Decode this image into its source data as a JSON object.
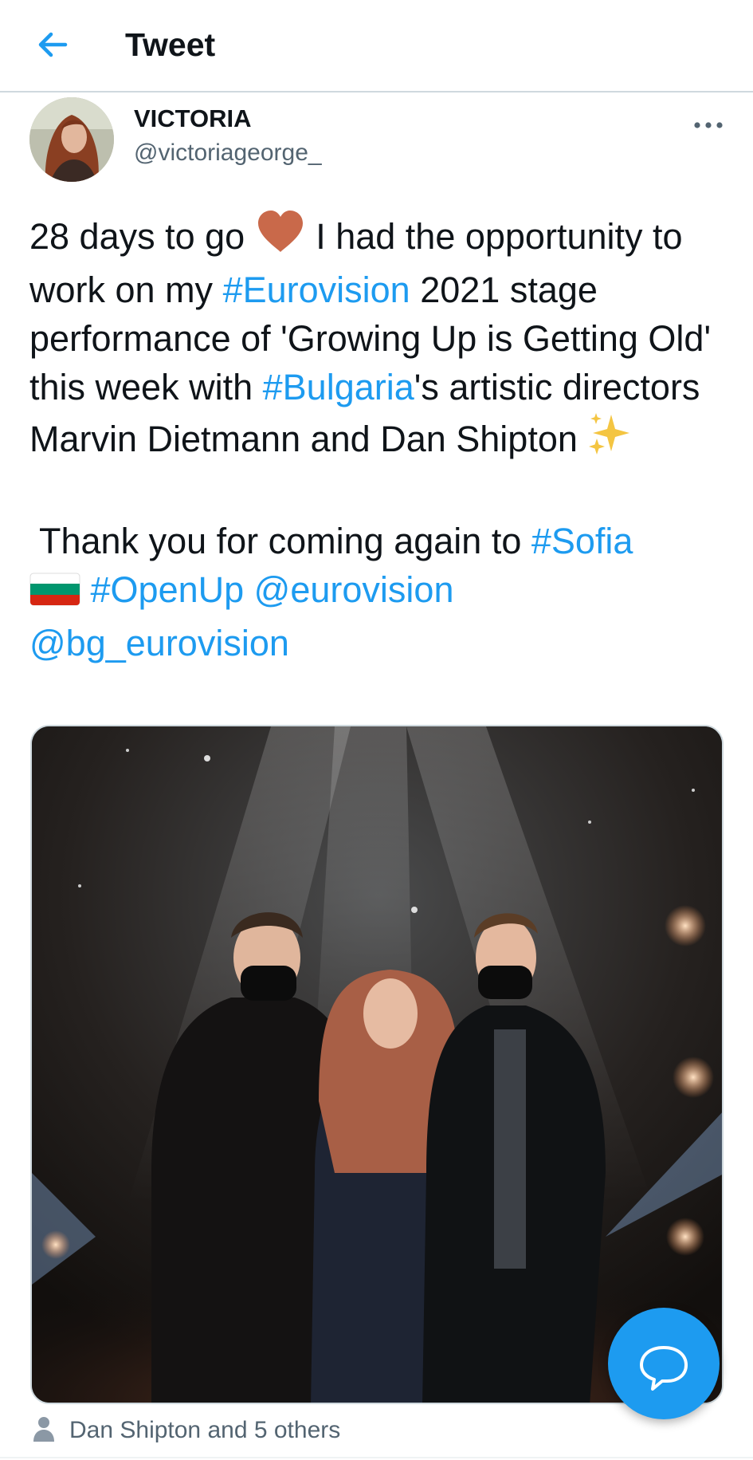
{
  "header": {
    "title": "Tweet"
  },
  "author": {
    "display_name": "VICTORIA",
    "handle": "@victoriageorge_"
  },
  "tweet": {
    "line1_pre": "28 days to go ",
    "line1_post": " I had the opportunity to work on my ",
    "hashtag_eurovision": "#Eurovision",
    "mid1": " 2021 stage performance of 'Growing Up is Getting Old' this week with ",
    "hashtag_bulgaria": "#Bulgaria",
    "mid2": "'s artistic directors Marvin Dietmann and Dan Shipton ",
    "para2_pre": "Thank you for coming again to ",
    "hashtag_sofia": "#Sofia",
    "hashtag_openup": "#OpenUp",
    "mention_eurovision": "@eurovision",
    "mention_bg": "@bg_eurovision"
  },
  "tagged": {
    "text": "Dan Shipton and 5 others"
  },
  "colors": {
    "accent": "#1d9bf0",
    "text": "#0f1419",
    "secondary": "#536471",
    "heart": "#c9694a"
  },
  "icons": {
    "back": "arrow-left-icon",
    "more": "more-dots-icon",
    "heart": "brown-heart-emoji",
    "sparkles": "sparkles-emoji",
    "flag": "bulgaria-flag-emoji",
    "person": "person-icon",
    "compose": "compose-reply-icon"
  }
}
